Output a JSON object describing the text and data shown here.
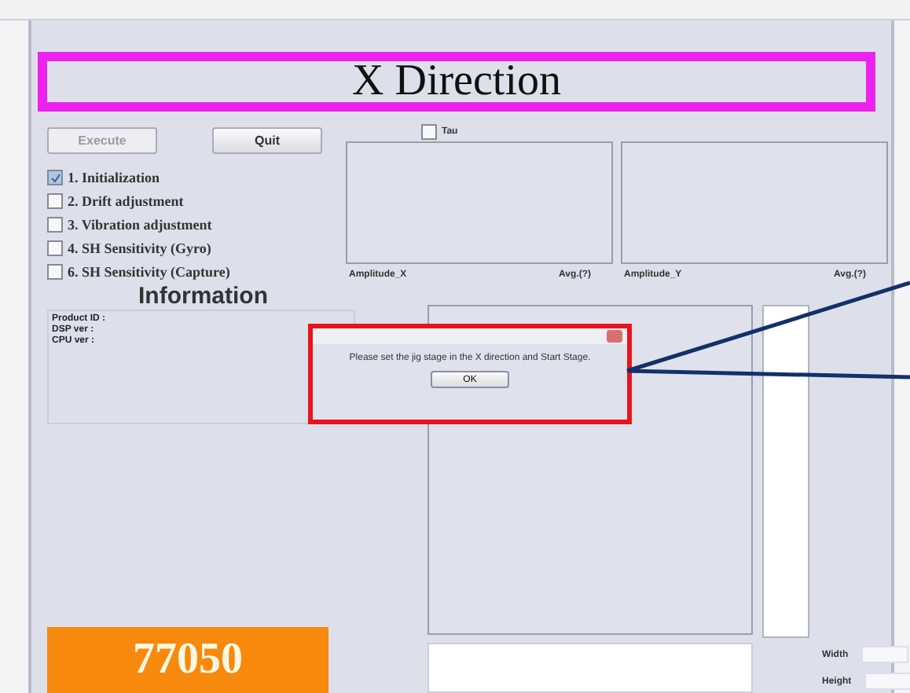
{
  "heading": "X Direction",
  "buttons": [
    {
      "label": "Execute",
      "disabled": true
    },
    {
      "label": "Quit",
      "disabled": false
    }
  ],
  "steps": [
    {
      "label": "1. Initialization",
      "checked": true
    },
    {
      "label": "2. Drift adjustment",
      "checked": false
    },
    {
      "label": "3. Vibration adjustment",
      "checked": false
    },
    {
      "label": "4. SH Sensitivity (Gyro)",
      "checked": false
    },
    {
      "label": "6. SH Sensitivity (Capture)",
      "checked": false
    }
  ],
  "information": {
    "title": "Information",
    "lines": [
      "Product ID :",
      "DSP ver :",
      "CPU ver :"
    ]
  },
  "counter": "77050",
  "tau": {
    "label": "Tau",
    "checked": false
  },
  "graphs": [
    {
      "label": "Amplitude_X",
      "avg_label": "Avg.(?)"
    },
    {
      "label": "Amplitude_Y",
      "avg_label": "Avg.(?)"
    }
  ],
  "size_fields": [
    {
      "label": "Width"
    },
    {
      "label": "Height"
    }
  ],
  "dialog": {
    "message": "Please set the jig stage in the X direction and Start Stage.",
    "button": "OK"
  }
}
